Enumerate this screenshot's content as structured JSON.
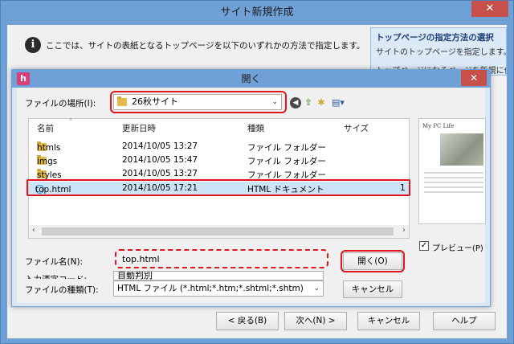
{
  "outer": {
    "title": "サイト新規作成",
    "close": "✕",
    "info_text": "ここでは、サイトの表紙となるトップページを以下のいずれかの方法で指定します。",
    "side_title": "トップページの指定方法の選択",
    "side_line1": "サイトのトップページを指定します。",
    "side_line2": "トップページになるページを新規に作",
    "buttons": {
      "back": "< 戻る(B)",
      "next": "次へ(N) >",
      "cancel": "キャンセル",
      "help": "ヘルプ"
    }
  },
  "dialog": {
    "title": "開く",
    "app_icon": "h",
    "close": "✕",
    "location_label": "ファイルの場所(I):",
    "location_value": "26秋サイト",
    "columns": {
      "name": "名前",
      "modified": "更新日時",
      "type": "種類",
      "size": "サイズ"
    },
    "files": [
      {
        "name": "htmls",
        "modified": "2014/10/05 13:27",
        "type": "ファイル フォルダー",
        "size": "",
        "icon": "folder-icon"
      },
      {
        "name": "imgs",
        "modified": "2014/10/05 15:47",
        "type": "ファイル フォルダー",
        "size": "",
        "icon": "folder-icon"
      },
      {
        "name": "styles",
        "modified": "2014/10/05 13:27",
        "type": "ファイル フォルダー",
        "size": "",
        "icon": "folder-icon"
      },
      {
        "name": "top.html",
        "modified": "2014/10/05 17:21",
        "type": "HTML ドキュメント",
        "size": "1",
        "icon": "html-file-icon"
      }
    ],
    "preview_title": "My PC Life",
    "preview_label": "プレビュー(P)",
    "filename_label": "ファイル名(N):",
    "filename_value": "top.html",
    "encoding_label": "入力漢字コード:",
    "encoding_value": "自動判別",
    "filetype_label": "ファイルの種類(T):",
    "filetype_value": "HTML ファイル (*.html;*.htm;*.shtml;*.shtm)",
    "open_button": "開く(O)",
    "cancel_button": "キャンセル"
  },
  "colors": {
    "accent": "#6fa0d6",
    "highlight": "#e0161d",
    "selection": "#cce4f7"
  }
}
